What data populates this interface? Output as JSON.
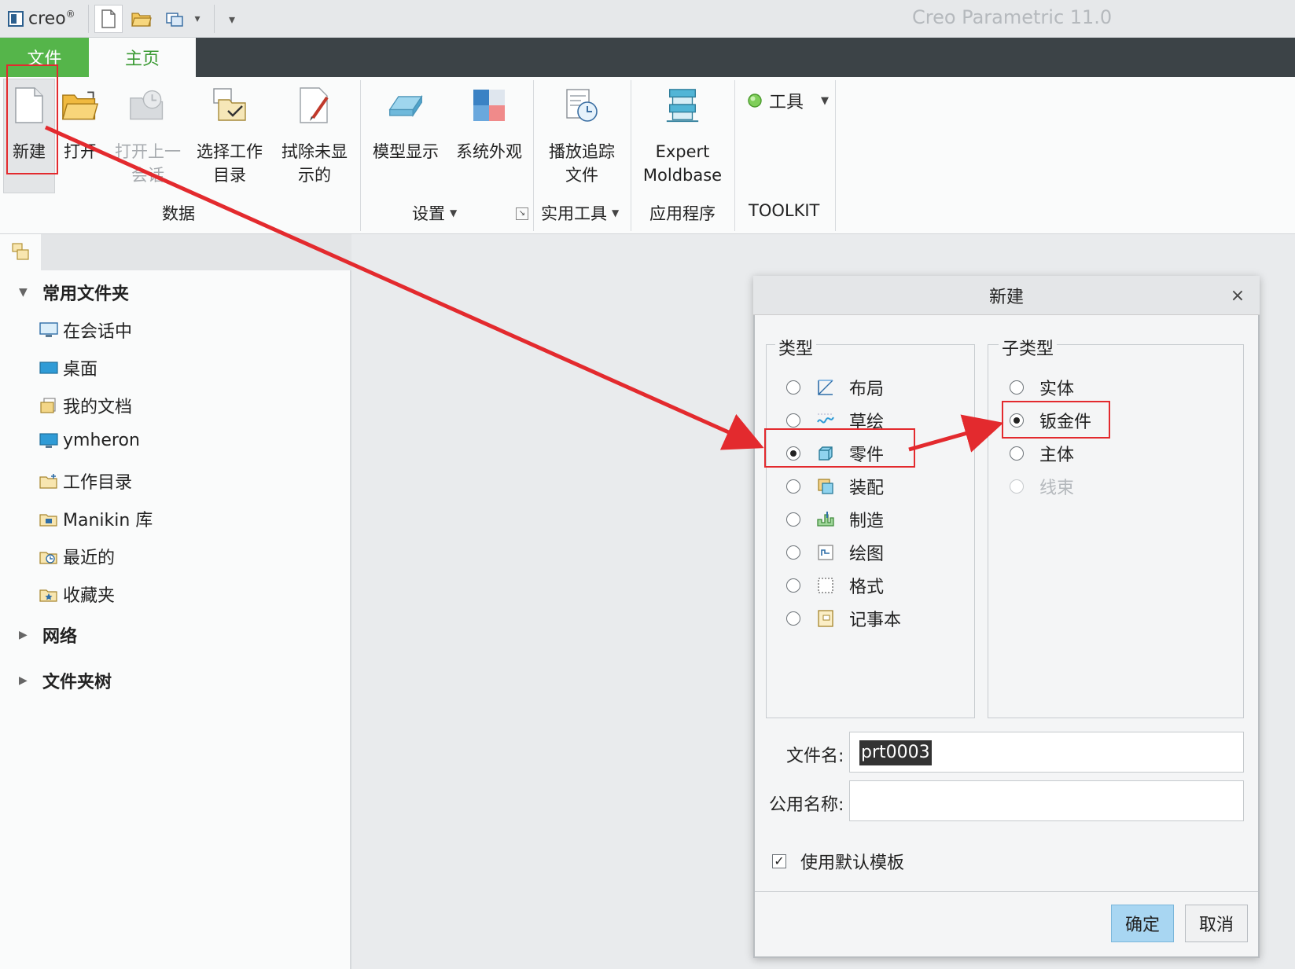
{
  "titlebar": {
    "logo_text": "creo",
    "logo_reg": "®",
    "app_title": "Creo Parametric 11.0",
    "qat": [
      {
        "name": "new-icon"
      },
      {
        "name": "open-folder-icon"
      },
      {
        "name": "window-icon"
      },
      {
        "name": "dropdown-icon",
        "glyph": "▾"
      },
      {
        "name": "customize-icon",
        "glyph": "▾"
      }
    ]
  },
  "ribbon": {
    "tabs": {
      "file": "文件",
      "home": "主页"
    },
    "buttons": {
      "new": "新建",
      "open": "打开",
      "open_last_1": "打开上一",
      "open_last_2": "会话",
      "select_dir_1": "选择工作",
      "select_dir_2": "目录",
      "erase_1": "拭除未显",
      "erase_2": "示的",
      "model_display": "模型显示",
      "system_appearance": "系统外观",
      "playback_1": "播放追踪",
      "playback_2": "文件",
      "expert_1": "Expert",
      "expert_2": "Moldbase",
      "tools": "工具"
    },
    "groups": {
      "data": "数据",
      "settings": "设置",
      "utilities": "实用工具",
      "applications": "应用程序",
      "toolkit": "TOOLKIT"
    }
  },
  "navigator": {
    "common_folders": "常用文件夹",
    "items": [
      {
        "label": "在会话中",
        "icon": "monitor-icon"
      },
      {
        "label": "桌面",
        "icon": "desktop-icon"
      },
      {
        "label": "我的文档",
        "icon": "documents-icon"
      },
      {
        "label": "ymheron",
        "icon": "computer-icon"
      },
      {
        "label": "工作目录",
        "icon": "working-dir-icon"
      },
      {
        "label": "Manikin 库",
        "icon": "library-icon"
      },
      {
        "label": "最近的",
        "icon": "recent-icon"
      },
      {
        "label": "收藏夹",
        "icon": "favorites-icon"
      }
    ],
    "network": "网络",
    "folder_tree": "文件夹树"
  },
  "dialog": {
    "title": "新建",
    "close": "×",
    "type_legend": "类型",
    "subtype_legend": "子类型",
    "types": [
      {
        "label": "布局",
        "selected": false
      },
      {
        "label": "草绘",
        "selected": false
      },
      {
        "label": "零件",
        "selected": true
      },
      {
        "label": "装配",
        "selected": false
      },
      {
        "label": "制造",
        "selected": false
      },
      {
        "label": "绘图",
        "selected": false
      },
      {
        "label": "格式",
        "selected": false
      },
      {
        "label": "记事本",
        "selected": false
      }
    ],
    "subtypes": [
      {
        "label": "实体",
        "selected": false,
        "enabled": true
      },
      {
        "label": "钣金件",
        "selected": true,
        "enabled": true
      },
      {
        "label": "主体",
        "selected": false,
        "enabled": true
      },
      {
        "label": "线束",
        "selected": false,
        "enabled": false
      }
    ],
    "filename_label": "文件名:",
    "filename_value": "prt0003",
    "common_name_label": "公用名称:",
    "common_name_value": "",
    "use_default_template": "使用默认模板",
    "use_default_template_checked": true,
    "ok": "确定",
    "cancel": "取消"
  },
  "colors": {
    "file_tab": "#55b54a",
    "home_tab_text": "#3a9a33",
    "annotation_red": "#e32a2e",
    "ok_button": "#a8d6f2"
  }
}
